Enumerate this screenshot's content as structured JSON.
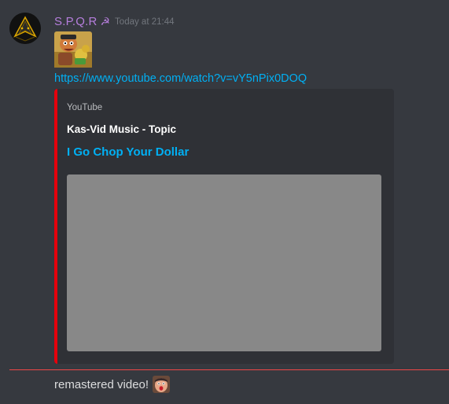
{
  "message": {
    "username": "S.P.Q.R",
    "badge_icon": "sickle-icon",
    "timestamp": "Today at 21:44",
    "link": "https://www.youtube.com/watch?v=vY5nPix0DOQ"
  },
  "embed": {
    "provider": "YouTube",
    "author": "Kas-Vid Music - Topic",
    "title": "I Go Chop Your Dollar",
    "accent_color": "#e6000c"
  },
  "message2": {
    "text": "remastered video!",
    "emoji": "shocked-face-emoji"
  },
  "colors": {
    "background": "#36393f",
    "embed_background": "#2f3136",
    "username": "#b57edc",
    "link": "#00b0f4",
    "new_messages_divider": "#f04747"
  }
}
